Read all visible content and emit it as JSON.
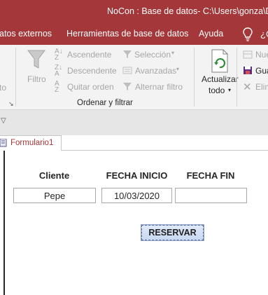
{
  "window": {
    "title": "NoCon : Base de datos- C:\\Users\\gonza\\Do"
  },
  "ribbon_tabs": [
    {
      "label": "atos externos"
    },
    {
      "label": "Herramientas de base de datos"
    },
    {
      "label": "Ayuda"
    }
  ],
  "ribbon": {
    "filter_label": "Filtro",
    "ascending": "Ascendente",
    "descending": "Descendente",
    "remove_sort": "Quitar orden",
    "selection": "Selección",
    "advanced": "Avanzadas",
    "toggle_filter": "Alternar filtro",
    "group_label": "Ordenar y filtrar",
    "refresh_line1": "Actualizar",
    "refresh_line2": "todo",
    "new_partial": "Nue",
    "save_partial": "Gua",
    "delete_partial": "Elim",
    "left_partial": "to",
    "colors": {
      "titlebar": "#a4373a",
      "ribbon": "#f3f3f3",
      "disabled_text": "#a6a6a6"
    }
  },
  "document_tab": {
    "label": "Formulario1"
  },
  "form": {
    "cliente_label": "Cliente",
    "fecha_inicio_label": "FECHA INICIO",
    "fecha_fin_label": "FECHA FIN",
    "cliente_value": "Pepe",
    "fecha_inicio_value": "10/03/2020",
    "fecha_fin_value": "",
    "reservar_label": "RESERVAR"
  }
}
